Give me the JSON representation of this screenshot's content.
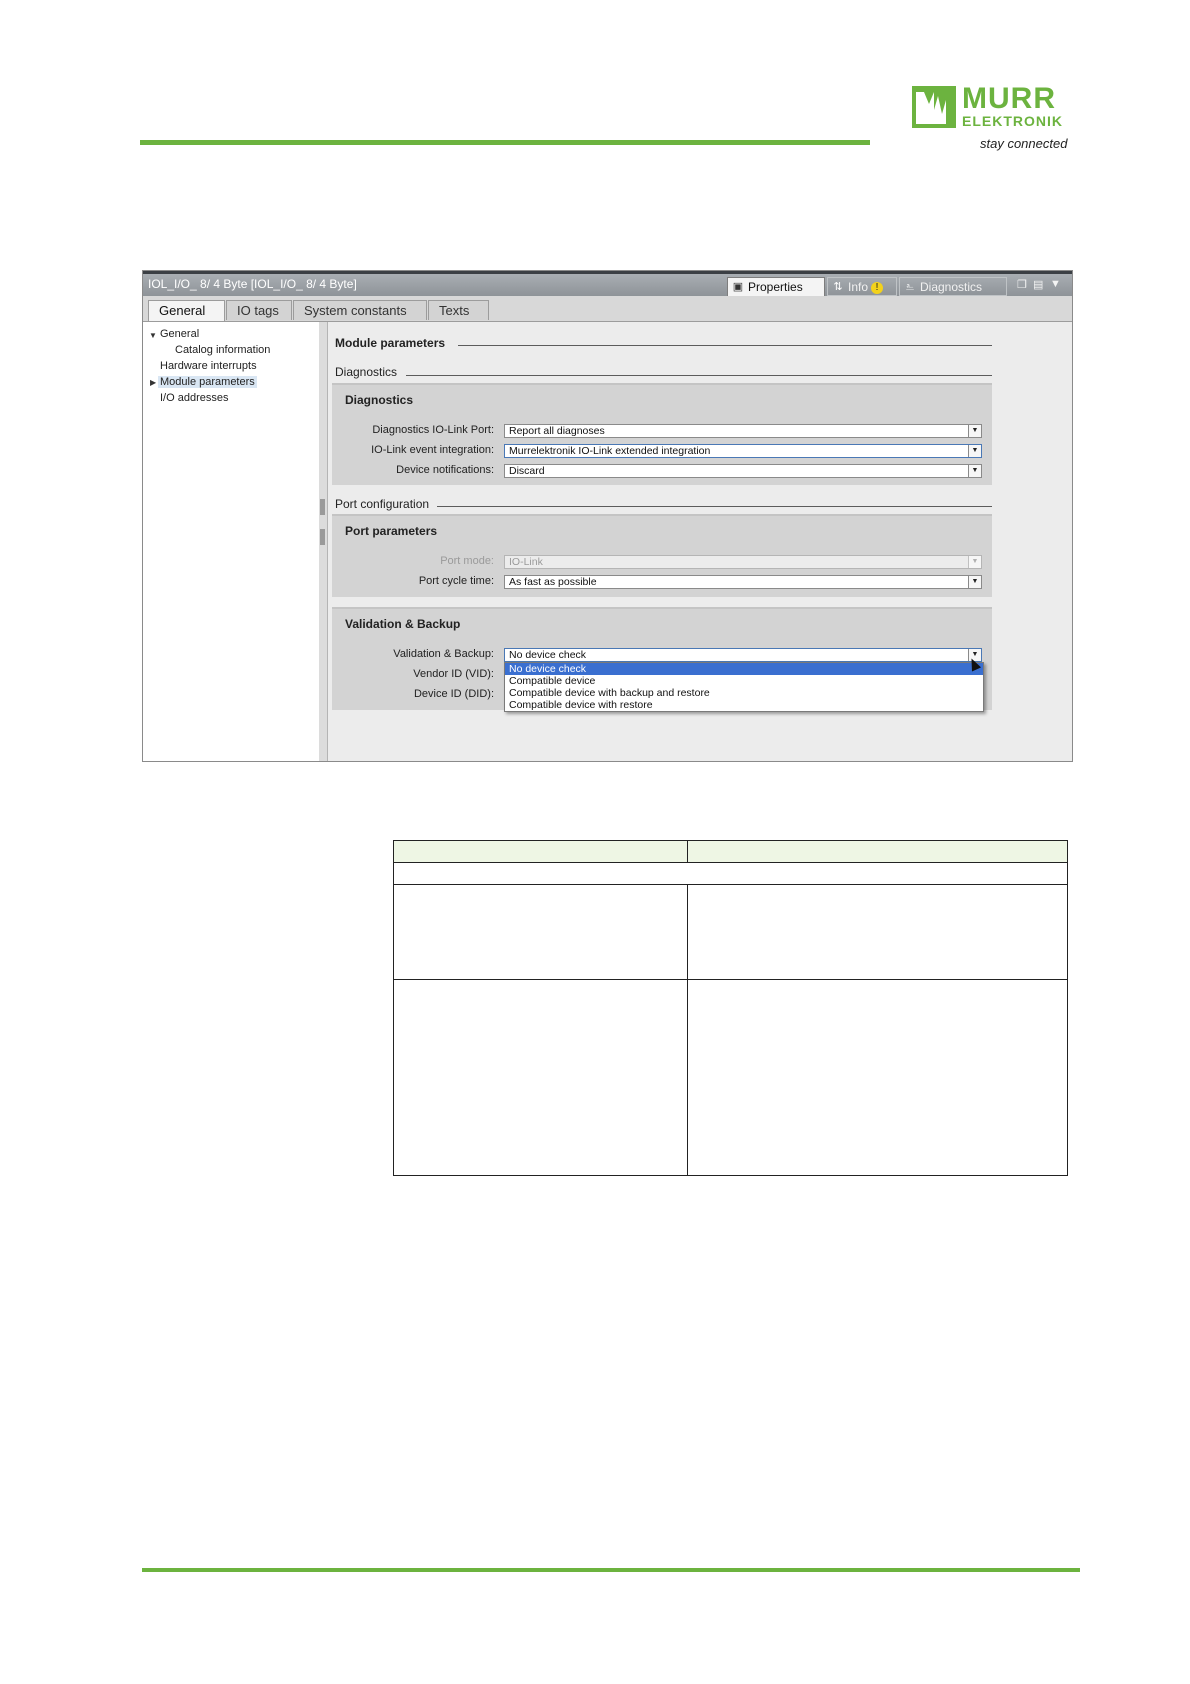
{
  "brand": {
    "name_line1": "MURR",
    "name_line2": "ELEKTRONIK",
    "tagline": "stay connected",
    "accent_color": "#6cb33f"
  },
  "window": {
    "title": "IOL_I/O_ 8/ 4 Byte [IOL_I/O_ 8/ 4 Byte]",
    "panel_tabs": [
      {
        "label": "Properties",
        "icon": "properties-icon"
      },
      {
        "label": "Info",
        "icon": "info-icon"
      },
      {
        "label": "Diagnostics",
        "icon": "diagnostics-icon"
      }
    ],
    "tabs": [
      "General",
      "IO tags",
      "System constants",
      "Texts"
    ]
  },
  "tree": {
    "items": [
      "General",
      "Catalog information",
      "Hardware interrupts",
      "Module parameters",
      "I/O addresses"
    ]
  },
  "content": {
    "module_parameters_heading": "Module parameters",
    "diagnostics_section": "Diagnostics",
    "diagnostics_group": {
      "title": "Diagnostics",
      "fields": [
        {
          "label": "Diagnostics IO-Link Port:",
          "value": "Report all diagnoses"
        },
        {
          "label": "IO-Link event integration:",
          "value": "Murrelektronik IO-Link extended integration"
        },
        {
          "label": "Device notifications:",
          "value": "Discard"
        }
      ]
    },
    "port_configuration_section": "Port configuration",
    "port_parameters_group": {
      "title": "Port parameters",
      "fields": [
        {
          "label": "Port mode:",
          "value": "IO-Link"
        },
        {
          "label": "Port cycle time:",
          "value": "As fast as possible"
        }
      ]
    },
    "validation_group": {
      "title": "Validation & Backup",
      "fields": [
        {
          "label": "Validation & Backup:",
          "value": "No device check"
        },
        {
          "label": "Vendor ID (VID):",
          "value": ""
        },
        {
          "label": "Device ID (DID):",
          "value": ""
        }
      ],
      "dropdown_options": [
        "No device check",
        "Compatible device",
        "Compatible device with backup and restore",
        "Compatible device with restore"
      ]
    }
  }
}
